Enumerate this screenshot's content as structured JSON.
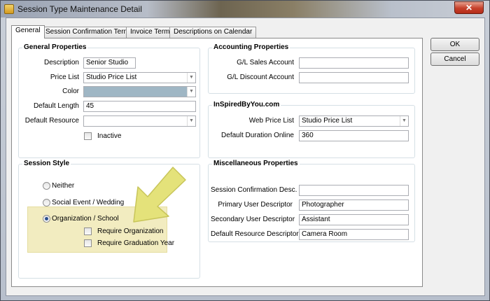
{
  "window": {
    "title": "Session Type Maintenance Detail",
    "close_glyph": "✕"
  },
  "tabs": [
    "General",
    "Session Confirmation Terms",
    "Invoice Terms",
    "Descriptions on Calendar"
  ],
  "general_properties": {
    "title": "General Properties",
    "description_label": "Description",
    "description_value": "Senior Studio",
    "price_list_label": "Price List",
    "price_list_value": "Studio Price List",
    "color_label": "Color",
    "default_length_label": "Default Length",
    "default_length_value": "45",
    "default_resource_label": "Default Resource",
    "default_resource_value": "",
    "inactive_label": "Inactive"
  },
  "accounting_properties": {
    "title": "Accounting Properties",
    "gl_sales_label": "G/L Sales Account",
    "gl_sales_value": "",
    "gl_discount_label": "G/L Discount Account",
    "gl_discount_value": ""
  },
  "inspired": {
    "title": "InSpiredByYou.com",
    "web_price_list_label": "Web Price List",
    "web_price_list_value": "Studio Price List",
    "duration_label": "Default Duration Online",
    "duration_value": "360"
  },
  "session_style": {
    "title": "Session Style",
    "neither_label": "Neither",
    "social_label": "Social Event / Wedding",
    "org_label": "Organization / School",
    "selected": "Organization / School",
    "require_org_label": "Require Organization",
    "require_grad_label": "Require Graduation Year"
  },
  "misc_properties": {
    "title": "Miscellaneous Properties",
    "confirm_desc_label": "Session Confirmation Desc.",
    "confirm_desc_value": "",
    "primary_label": "Primary User Descriptor",
    "primary_value": "Photographer",
    "secondary_label": "Secondary User Descriptor",
    "secondary_value": "Assistant",
    "resource_label": "Default Resource Descriptor",
    "resource_value": "Camera Room"
  },
  "buttons": {
    "ok": "OK",
    "cancel": "Cancel"
  },
  "colors": {
    "color_swatch": "#9fb6c4",
    "annotation_arrow": "#e4e27a",
    "highlight": "#f2ecc0"
  },
  "combo_glyph": "▼"
}
